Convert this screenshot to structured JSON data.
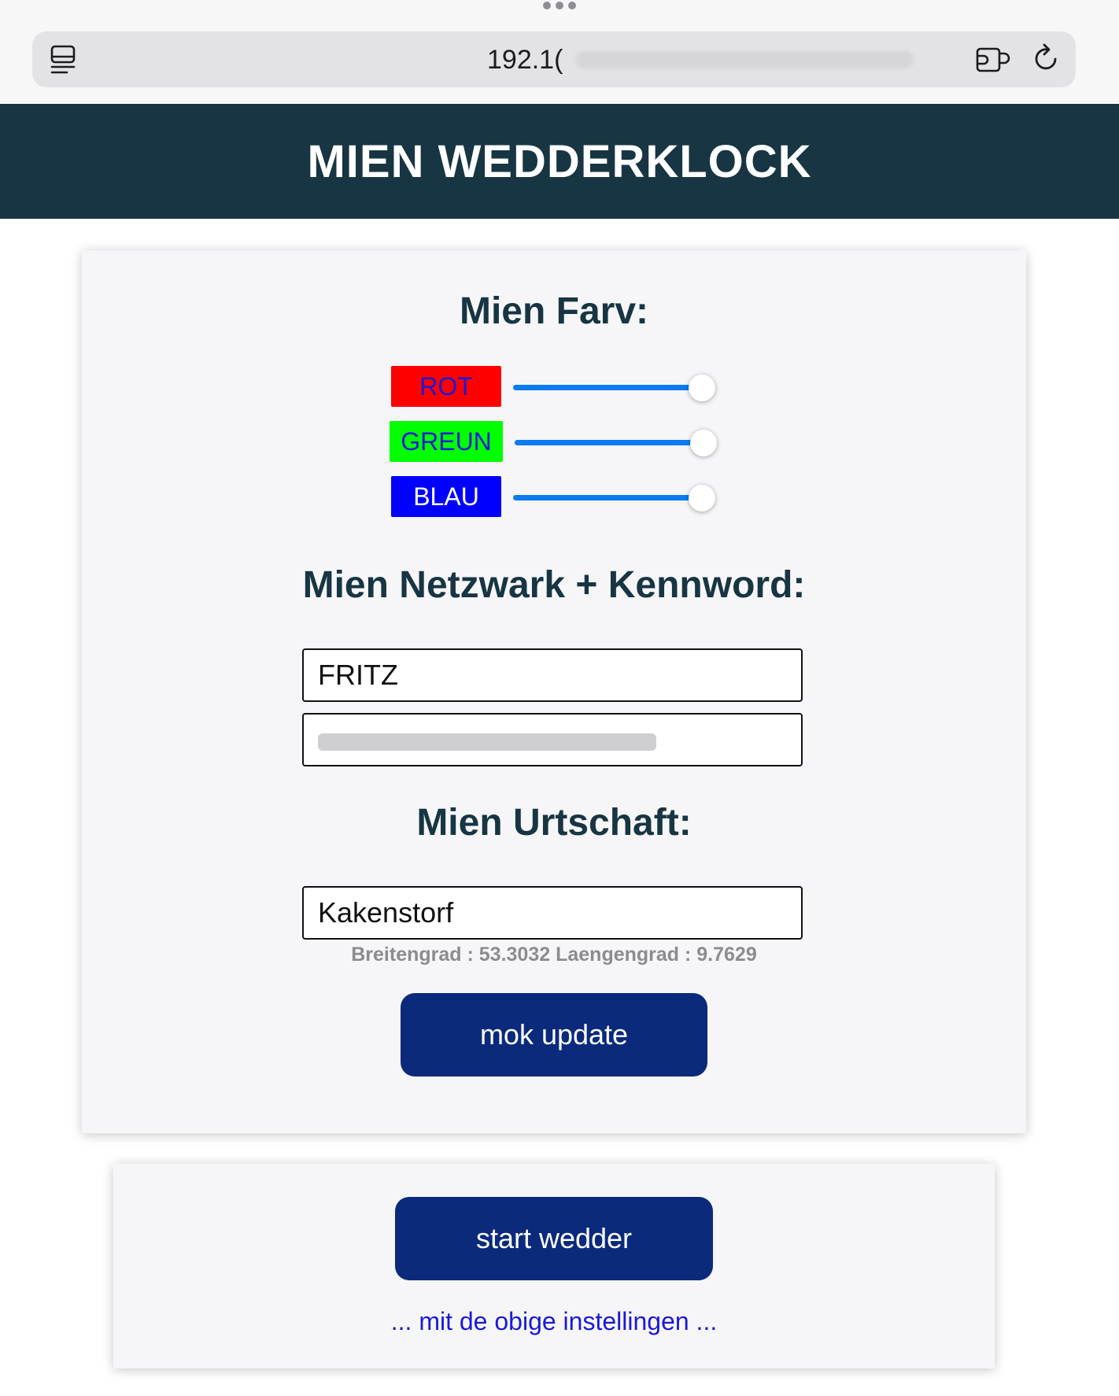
{
  "browser": {
    "url": "192.1(",
    "icons": {
      "sidebar": "sidebar-icon",
      "share": "share-icon",
      "reload": "reload-icon"
    }
  },
  "header": {
    "title": "MIEN WEDDERKLOCK",
    "bg_color": "#173542"
  },
  "colors": {
    "title": "Mien Farv:",
    "items": [
      {
        "label": "ROT",
        "bg": "#ff0000",
        "text_color": "#1a1ad6",
        "level": 1.0
      },
      {
        "label": "GREUN",
        "bg": "#00ff00",
        "text_color": "#1a1ad6",
        "level": 1.0
      },
      {
        "label": "BLAU",
        "bg": "#0000ff",
        "text_color": "#ffffff",
        "level": 1.0
      }
    ],
    "slider_color": "#0a7bf0"
  },
  "network": {
    "title": "Mien Netzwark + Kennword:",
    "ssid_value": "FRITZ",
    "password_redacted": true
  },
  "location": {
    "title": "Mien Urtschaft:",
    "value": "Kakenstorf",
    "coords_text": "Breitengrad : 53.3032 Laengengrad : 9.7629"
  },
  "buttons": {
    "update_label": "mok update",
    "start_label": "start wedder",
    "color": "#0b2a7c"
  },
  "footer_note": "... mit de obige instellingen ..."
}
